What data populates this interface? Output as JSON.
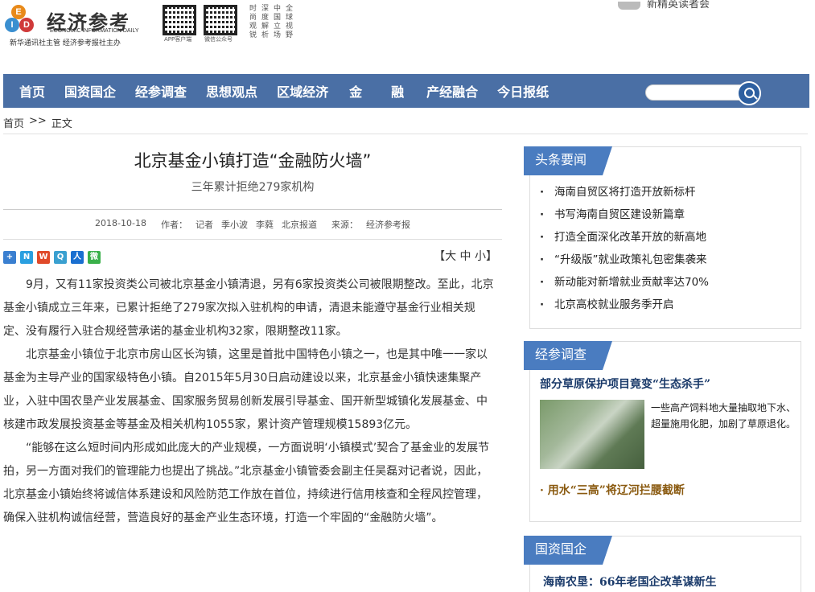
{
  "header": {
    "logo_letters": [
      "E",
      "I",
      "D"
    ],
    "logo_title": "经济参考",
    "logo_en": "ECONOMIC INFORMATION DAILY",
    "logo_sub": "新华通讯社主管 经济参考报社主办",
    "qr_app_label": "APP客户端",
    "qr_wechat_label": "微信公众号",
    "slogan_cols": [
      "时尚观锐",
      "深度解析",
      "中国立场",
      "全球视野"
    ],
    "promo_text": "新精英读者会"
  },
  "nav": {
    "items": [
      "首页",
      "国资国企",
      "经参调查",
      "思想观点",
      "区域经济",
      "金",
      "融",
      "产经融合",
      "今日报纸"
    ],
    "search_placeholder": ""
  },
  "breadcrumb": {
    "home": "首页",
    "separator": ">>",
    "current": "正文"
  },
  "article": {
    "title": "北京基金小镇打造“金融防火墙”",
    "subtitle": "三年累计拒绝279家机构",
    "date": "2018-10-18",
    "author_label": "作者：",
    "authors": [
      "记者",
      "季小波",
      "李蕤",
      "北京报道"
    ],
    "source_label": "来源：",
    "source": "经济参考报",
    "font_size_label": "【大 中 小】",
    "paragraphs": [
      "9月，又有11家投资类公司被北京基金小镇清退，另有6家投资类公司被限期整改。至此，北京基金小镇成立三年来，已累计拒绝了279家次拟入驻机构的申请，清退未能遵守基金行业相关规定、没有履行入驻合规经营承诺的基金业机构32家，限期整改11家。",
      "北京基金小镇位于北京市房山区长沟镇，这里是首批中国特色小镇之一，也是其中唯一一家以基金为主导产业的国家级特色小镇。自2015年5月30日启动建设以来，北京基金小镇快速集聚产业，入驻中国农垦产业发展基金、国家服务贸易创新发展引导基金、国开新型城镇化发展基金、中核建市政发展投资基金等基金及相关机构1055家，累计资产管理规模15893亿元。",
      "“能够在这么短时间内形成如此庞大的产业规模，一方面说明‘小镇模式’契合了基金业的发展节拍，另一方面对我们的管理能力也提出了挑战。”北京基金小镇管委会副主任吴磊对记者说，因此，北京基金小镇始终将诚信体系建设和风险防范工作放在首位，持续进行信用核查和全程风控管理，确保入驻机构诚信经营，营造良好的基金产业生态环境，打造一个牢固的“金融防火墙”。"
    ]
  },
  "sidebar": {
    "headlines": {
      "tab": "头条要闻",
      "items": [
        "海南自贸区将打造开放新标杆",
        "书写海南自贸区建设新篇章",
        "打造全面深化改革开放的新高地",
        "“升级版”就业政策礼包密集袭来",
        "新动能对新增就业贡献率达70%",
        "北京高校就业服务季开启"
      ]
    },
    "survey": {
      "tab": "经参调查",
      "feature_title": "部分草原保护项目竟变“生态杀手”",
      "feature_desc": "一些高产饲料地大量抽取地下水、超量施用化肥，加剧了草原退化。",
      "link": "· 用水“三高”将辽河拦腰截断"
    },
    "soe": {
      "tab": "国资国企",
      "feature_title": "海南农垦：66年老国企改革谋新生"
    }
  },
  "colors": {
    "nav_bg": "#4a6fa5",
    "tab_bg": "#4a7cc0",
    "search_btn": "#2d5fa0"
  }
}
